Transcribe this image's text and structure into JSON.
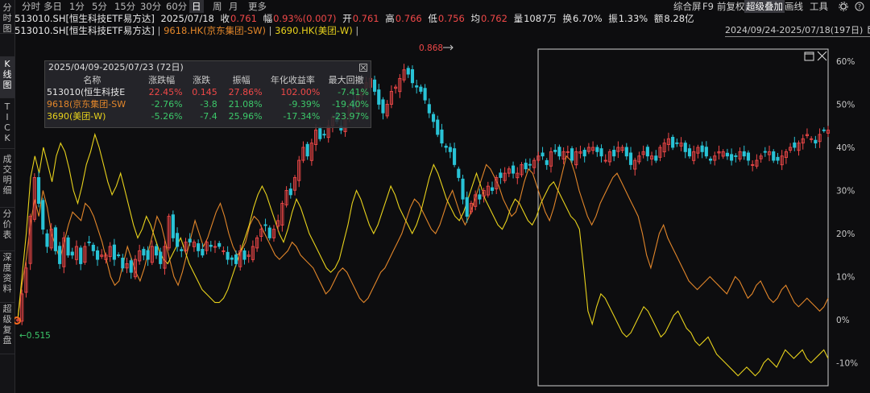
{
  "sidebar": {
    "tabs": [
      {
        "label": "分时图",
        "active": false
      },
      {
        "label": "K线图",
        "active": true
      },
      {
        "label": "TICK",
        "active": false
      },
      {
        "label": "成交明细",
        "active": false
      },
      {
        "label": "分价表",
        "active": false
      },
      {
        "label": "深度资料",
        "active": false
      },
      {
        "label": "超级复盘",
        "active": false
      }
    ]
  },
  "periods": [
    "分时",
    "多日",
    "1分",
    "5分",
    "15分",
    "30分",
    "60分",
    "日",
    "周",
    "月",
    "更多"
  ],
  "period_active": "日",
  "toolbar": {
    "items": [
      "综合屏",
      "F9",
      "前复权",
      "超级叠加",
      "画线",
      "工具"
    ],
    "active": "超级叠加",
    "settings_icon": "gear-icon",
    "help_icon": "help-icon"
  },
  "quote": {
    "name": "513010.SH[恒生科技ETF易方达]",
    "date": "2025/07/18",
    "close_label": "收",
    "close": "0.761",
    "change_label": "幅",
    "change": "0.93%(0.007)",
    "open_label": "开",
    "open": "0.761",
    "high_label": "高",
    "high": "0.766",
    "low_label": "低",
    "low": "0.756",
    "avg_label": "均",
    "avg": "0.762",
    "volume_label": "量",
    "volume": "1087万",
    "turnover_label": "换",
    "turnover": "6.70%",
    "amplitude_label": "振",
    "amplitude": "1.33%",
    "amount_label": "额",
    "amount": "8.28亿"
  },
  "legend": {
    "s1": "513010.SH[恒生科技ETF易方达]",
    "sep1": " | ",
    "s2": "9618.HK(京东集团-SW)",
    "sep2": " | ",
    "s3": "3690.HK(美团-W)",
    "sep3": " |"
  },
  "range_label": "2024/09/24-2025/07/18(197日)",
  "range_icon": "calendar-icon",
  "stats_panel": {
    "title": "2025/04/09-2025/07/23 (72日)",
    "close_icon": "close-icon",
    "headers": [
      "名称",
      "涨跌幅",
      "涨跌",
      "振幅",
      "年化收益率",
      "最大回撤"
    ],
    "rows": [
      {
        "name": "513010(恒生科技E",
        "pct": "22.45%",
        "chg": "0.145",
        "amp": "27.86%",
        "ann": "102.00%",
        "dd": "-7.41%"
      },
      {
        "name": "9618(京东集团-SW",
        "pct": "-2.76%",
        "chg": "-3.8",
        "amp": "21.08%",
        "ann": "-9.39%",
        "dd": "-19.40%"
      },
      {
        "name": "3690(美团-W)",
        "pct": "-5.26%",
        "chg": "-7.4",
        "amp": "25.96%",
        "ann": "-17.34%",
        "dd": "-23.97%"
      }
    ]
  },
  "colors": {
    "up": "#f04848",
    "down": "#29c3d6",
    "s2": "#e2862a",
    "s3": "#e8d21c",
    "axis_text": "#c8c8c8",
    "selection": "#cfcfcf",
    "background": "#0d0d0f"
  },
  "chart_data": {
    "type": "line",
    "y_axis": {
      "ticks": [
        "60%",
        "50%",
        "40%",
        "30%",
        "20%",
        "10%",
        "0%",
        "-10%"
      ],
      "ylim": [
        -14,
        63
      ],
      "position": "right"
    },
    "annotations": {
      "max_label": "0.868",
      "min_label": "0.515"
    },
    "series": [
      {
        "name": "9618.HK(京东集团-SW)",
        "color": "#e2862a",
        "values": [
          0,
          8,
          14,
          22,
          28,
          24,
          30,
          26,
          20,
          17,
          14,
          18,
          22,
          25,
          24,
          23,
          27,
          26,
          24,
          21,
          18,
          14,
          10,
          8,
          9,
          13,
          17,
          14,
          11,
          9,
          12,
          16,
          20,
          24,
          22,
          18,
          14,
          10,
          8,
          11,
          15,
          19,
          23,
          20,
          17,
          19,
          22,
          25,
          27,
          24,
          20,
          17,
          15,
          16,
          18,
          22,
          24,
          23,
          21,
          19,
          17,
          15,
          14,
          15,
          16,
          18,
          17,
          15,
          14,
          13,
          12,
          10,
          8,
          6,
          7,
          9,
          11,
          12,
          11,
          9,
          7,
          5,
          4,
          5,
          7,
          9,
          11,
          12,
          14,
          16,
          18,
          20,
          23,
          26,
          28,
          27,
          25,
          23,
          21,
          20,
          22,
          25,
          28,
          30,
          27,
          24,
          22,
          24,
          27,
          30,
          33,
          36,
          35,
          33,
          31,
          28,
          26,
          24,
          25,
          28,
          32,
          35,
          34,
          31,
          28,
          25,
          23,
          26,
          30,
          34,
          38,
          37,
          34,
          30,
          27,
          24,
          22,
          24,
          27,
          29,
          31,
          33,
          34,
          32,
          30,
          28,
          26,
          24,
          20,
          15,
          12,
          16,
          20,
          22,
          19,
          17,
          15,
          13,
          11,
          9,
          8,
          7,
          8,
          9,
          10,
          9,
          8,
          7,
          6,
          8,
          10,
          9,
          7,
          5,
          6,
          8,
          9,
          7,
          5,
          4,
          5,
          7,
          8,
          6,
          4,
          3,
          4,
          5,
          4,
          3,
          2,
          3,
          5
        ],
        "values_note": "approx percent"
      },
      {
        "name": "3690.HK(美团-W)",
        "color": "#e8d21c",
        "values": [
          0,
          10,
          20,
          33,
          38,
          34,
          40,
          36,
          32,
          38,
          41,
          39,
          35,
          30,
          27,
          31,
          36,
          39,
          43,
          40,
          36,
          32,
          29,
          31,
          34,
          30,
          26,
          22,
          19,
          21,
          24,
          22,
          19,
          16,
          14,
          13,
          15,
          17,
          19,
          16,
          13,
          11,
          9,
          7,
          6,
          5,
          4,
          4,
          5,
          7,
          10,
          13,
          16,
          19,
          22,
          26,
          29,
          31,
          29,
          26,
          23,
          20,
          18,
          21,
          25,
          28,
          26,
          23,
          20,
          18,
          16,
          14,
          12,
          11,
          12,
          14,
          18,
          22,
          27,
          30,
          28,
          25,
          22,
          20,
          22,
          25,
          28,
          31,
          29,
          26,
          24,
          22,
          20,
          22,
          25,
          29,
          33,
          36,
          34,
          31,
          28,
          26,
          24,
          23,
          25,
          28,
          31,
          34,
          31,
          28,
          26,
          24,
          22,
          21,
          23,
          26,
          28,
          27,
          25,
          23,
          22,
          24,
          27,
          29,
          31,
          32,
          30,
          28,
          26,
          24,
          23,
          21,
          12,
          2,
          -1,
          3,
          6,
          5,
          3,
          1,
          -1,
          -3,
          -4,
          -3,
          -1,
          1,
          3,
          2,
          0,
          -2,
          -4,
          -3,
          -1,
          1,
          2,
          0,
          -2,
          -3,
          -5,
          -6,
          -5,
          -4,
          -6,
          -8,
          -9,
          -10,
          -11,
          -12,
          -13,
          -12,
          -11,
          -12,
          -13,
          -12,
          -10,
          -9,
          -10,
          -11,
          -9,
          -7,
          -8,
          -9,
          -8,
          -7,
          -9,
          -10,
          -9,
          -8,
          -7,
          -9
        ],
        "values_note": "approx percent"
      },
      {
        "name": "513010.SH[恒生科技ETF易方达]",
        "color": "#29c3d6",
        "candles": true,
        "close": [
          0,
          6,
          12,
          24,
          33,
          27,
          21,
          17,
          21,
          16,
          13,
          19,
          15,
          15,
          17,
          13,
          17,
          18,
          16,
          14,
          15,
          15,
          17,
          14,
          15,
          12,
          13,
          11,
          14,
          16,
          15,
          14,
          17,
          15,
          13,
          17,
          24,
          19,
          17,
          16,
          18,
          18,
          18,
          16,
          15,
          18,
          17,
          17,
          17,
          16,
          14,
          14,
          13,
          16,
          14,
          15,
          17,
          19,
          21,
          22,
          19,
          21,
          23,
          27,
          30,
          29,
          33,
          37,
          40,
          38,
          41,
          44,
          42,
          43,
          45,
          47,
          46,
          44,
          47,
          50,
          49,
          52,
          53,
          55,
          56,
          53,
          50,
          48,
          50,
          53,
          54,
          56,
          58,
          57,
          55,
          54,
          53,
          51,
          48,
          46,
          43,
          41,
          40,
          39,
          36,
          33,
          28,
          24,
          27,
          29,
          28,
          30,
          31,
          30,
          33,
          33,
          34,
          35,
          34,
          34,
          36,
          35,
          36,
          37,
          38,
          38,
          36,
          39,
          39,
          38,
          39,
          39,
          37,
          39,
          39,
          38,
          40,
          40,
          39,
          38,
          37,
          39,
          38,
          40,
          40,
          38,
          36,
          37,
          38,
          39,
          38,
          38,
          37,
          40,
          41,
          42,
          40,
          41,
          41,
          39,
          38,
          39,
          40,
          39,
          38,
          37,
          38,
          39,
          39,
          38,
          37,
          38,
          39,
          38,
          37,
          36,
          37,
          38,
          39,
          39,
          37,
          37,
          38,
          39,
          40,
          40,
          41,
          42,
          43,
          42,
          41,
          43,
          44,
          44
        ]
      }
    ]
  }
}
